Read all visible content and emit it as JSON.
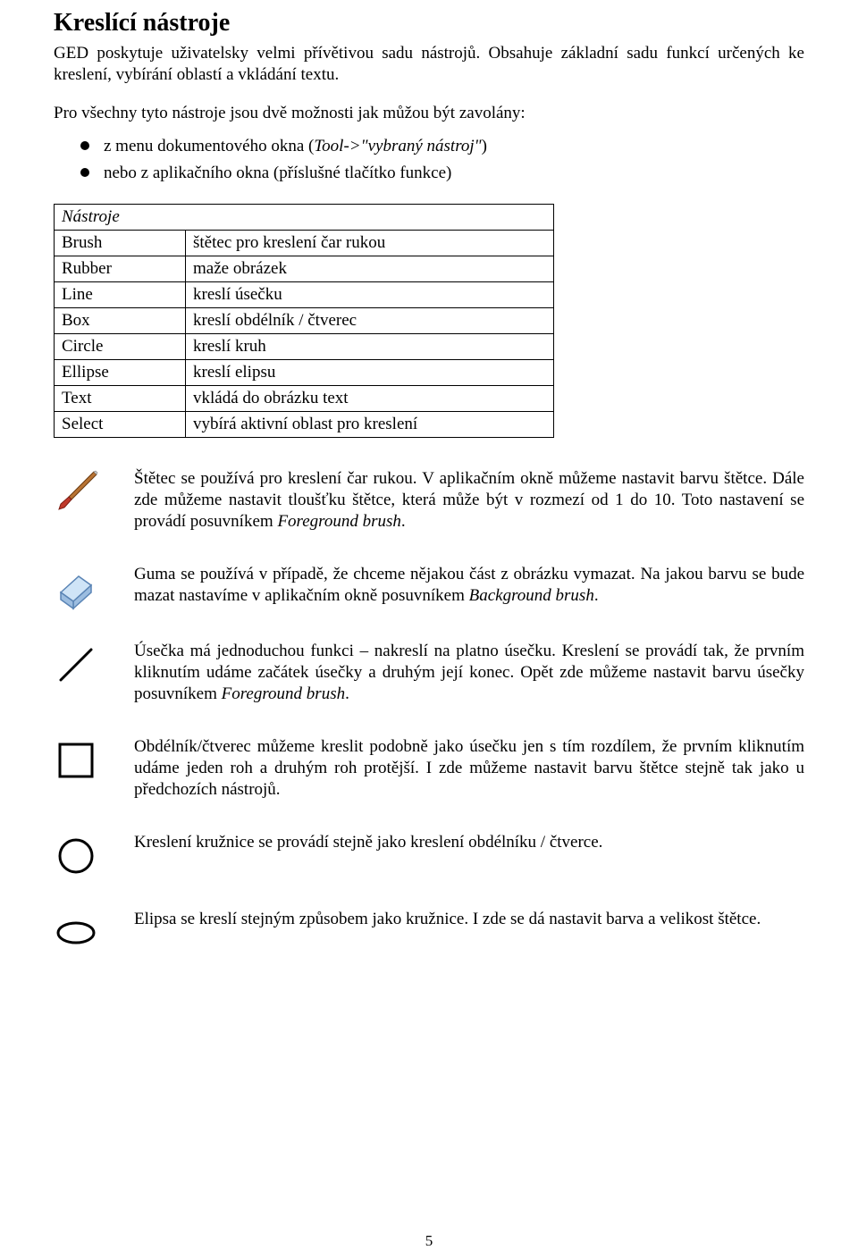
{
  "title": "Kreslící nástroje",
  "intro": "GED poskytuje uživatelsky velmi přívětivou sadu nástrojů. Obsahuje základní sadu funkcí určených ke kreslení, vybírání oblastí a vkládání textu.",
  "list_lead": "Pro všechny tyto nástroje jsou dvě možnosti jak můžou být zavolány:",
  "bullet1_prefix": "z menu dokumentového okna (",
  "bullet1_italic": "Tool->\"vybraný nástroj\"",
  "bullet1_suffix": ")",
  "bullet2": "nebo z aplikačního okna (příslušné tlačítko funkce)",
  "table_header": "Nástroje",
  "table_rows": [
    {
      "name": "Brush",
      "desc": "štětec pro kreslení čar rukou"
    },
    {
      "name": "Rubber",
      "desc": "maže obrázek"
    },
    {
      "name": "Line",
      "desc": "kreslí úsečku"
    },
    {
      "name": "Box",
      "desc": "kreslí obdélník / čtverec"
    },
    {
      "name": "Circle",
      "desc": "kreslí kruh"
    },
    {
      "name": "Ellipse",
      "desc": "kreslí elipsu"
    },
    {
      "name": "Text",
      "desc": "vkládá do obrázku text"
    },
    {
      "name": "Select",
      "desc": "vybírá aktivní oblast pro kreslení"
    }
  ],
  "tool_desc": {
    "brush_p1": "Štětec se používá pro kreslení čar rukou. V aplikačním okně můžeme nastavit barvu štětce. Dále zde můžeme nastavit tloušťku štětce, která může být v rozmezí od 1 do 10. Toto nastavení se provádí posuvníkem ",
    "brush_i": "Foreground brush",
    "brush_p2": ".",
    "eraser_p1": "Guma se používá v případě, že chceme nějakou část z obrázku vymazat. Na jakou barvu se bude mazat nastavíme v aplikačním okně posuvníkem ",
    "eraser_i": "Background brush",
    "eraser_p2": ".",
    "line_p1": "Úsečka má jednoduchou funkci – nakreslí na platno úsečku. Kreslení se provádí tak, že prvním kliknutím udáme začátek úsečky a druhým její konec. Opět zde můžeme nastavit barvu úsečky posuvníkem ",
    "line_i": "Foreground brush",
    "line_p2": ".",
    "box": "Obdélník/čtverec můžeme kreslit podobně jako úsečku jen s tím rozdílem, že prvním kliknutím udáme jeden roh a druhým roh protější. I zde můžeme nastavit barvu štětce stejně tak jako u předchozích nástrojů.",
    "circle": "Kreslení kružnice se provádí stejně jako kreslení obdélníku / čtverce.",
    "ellipse": "Elipsa se kreslí stejným způsobem jako kružnice. I zde se dá nastavit barva a velikost štětce."
  },
  "page_number": "5"
}
